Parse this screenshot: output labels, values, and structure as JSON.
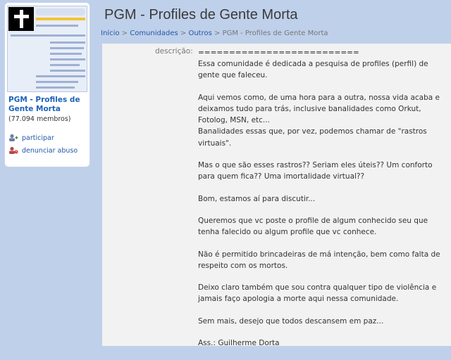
{
  "sidebar": {
    "community_name": "PGM - Profiles de Gente Morta",
    "members": "(77.094 membros)",
    "links": [
      {
        "label": "participar",
        "icon": "add-user-icon"
      },
      {
        "label": "denunciar abuso",
        "icon": "report-icon"
      }
    ]
  },
  "page": {
    "title": "PGM - Profiles de Gente Morta"
  },
  "breadcrumb": [
    {
      "label": "Início",
      "link": true
    },
    {
      "label": "Comunidades",
      "link": true
    },
    {
      "label": "Outros",
      "link": true
    },
    {
      "label": "PGM - Profiles de Gente Morta",
      "link": false
    }
  ],
  "breadcrumb_sep": " > ",
  "description": {
    "label": "descrição:",
    "paragraphs": [
      "==========================\nEssa comunidade é dedicada a pesquisa de profiles (perfil) de gente que faleceu.",
      "Aqui vemos como, de uma hora para a outra, nossa vida acaba e deixamos tudo para trás, inclusive banalidades como Orkut, Fotolog, MSN, etc...\nBanalidades essas que, por vez, podemos chamar de \"rastros virtuais\".",
      "Mas o que são esses rastros?? Seriam eles úteis?? Um conforto para quem fica?? Uma imortalidade virtual??",
      "Bom, estamos aí para discutir...",
      "Queremos que vc poste o profile de algum conhecido seu que tenha falecido ou algum profile que vc conhece.",
      "Não é permitido brincadeiras de má intenção, bem como falta de respeito com os mortos.",
      "Deixo claro também que sou contra qualquer tipo de violência e jamais faço apologia a morte aqui nessa comunidade.",
      "Sem mais, desejo que todos descansem em paz...",
      "Ass.: Guilherme Dorta"
    ]
  }
}
